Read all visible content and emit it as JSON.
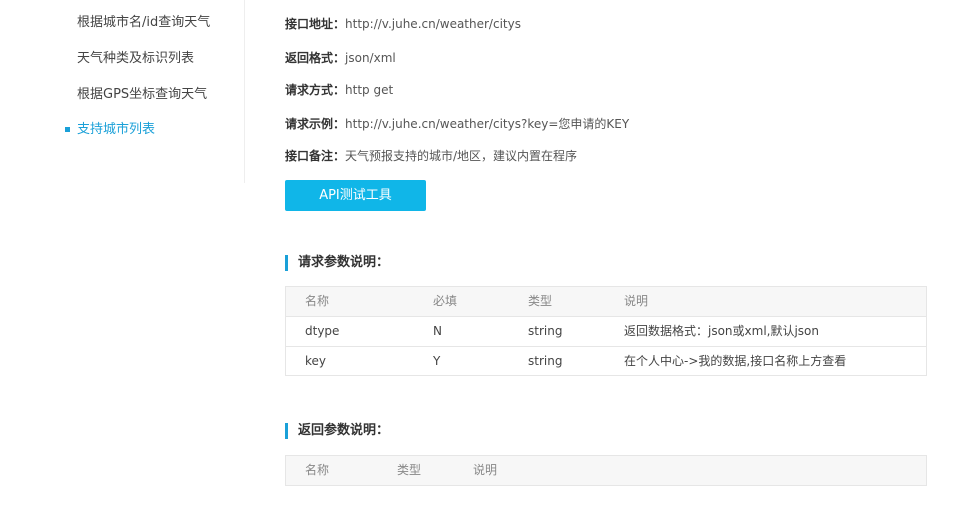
{
  "sidebar": {
    "items": [
      {
        "label": "根据城市名/id查询天气",
        "active": false
      },
      {
        "label": "天气种类及标识列表",
        "active": false
      },
      {
        "label": "根据GPS坐标查询天气",
        "active": false
      },
      {
        "label": "支持城市列表",
        "active": true
      }
    ],
    "accent_color": "#1aa0d8"
  },
  "api_info": {
    "url_label": "接口地址：",
    "url_value": "http://v.juhe.cn/weather/citys",
    "format_label": "返回格式：",
    "format_value": "json/xml",
    "method_label": "请求方式：",
    "method_value": "http get",
    "example_label": "请求示例：",
    "example_value": "http://v.juhe.cn/weather/citys?key=您申请的KEY",
    "note_label": "接口备注：",
    "note_value": "天气预报支持的城市/地区，建议内置在程序"
  },
  "test_button": {
    "label": "API测试工具",
    "color": "#10b6e8"
  },
  "request_params": {
    "title": "请求参数说明：",
    "headers": [
      "名称",
      "必填",
      "类型",
      "说明"
    ],
    "rows": [
      [
        "dtype",
        "N",
        "string",
        "返回数据格式：json或xml,默认json"
      ],
      [
        "key",
        "Y",
        "string",
        "在个人中心->我的数据,接口名称上方查看"
      ]
    ]
  },
  "response_params": {
    "title": "返回参数说明：",
    "headers": [
      "名称",
      "类型",
      "说明"
    ]
  }
}
